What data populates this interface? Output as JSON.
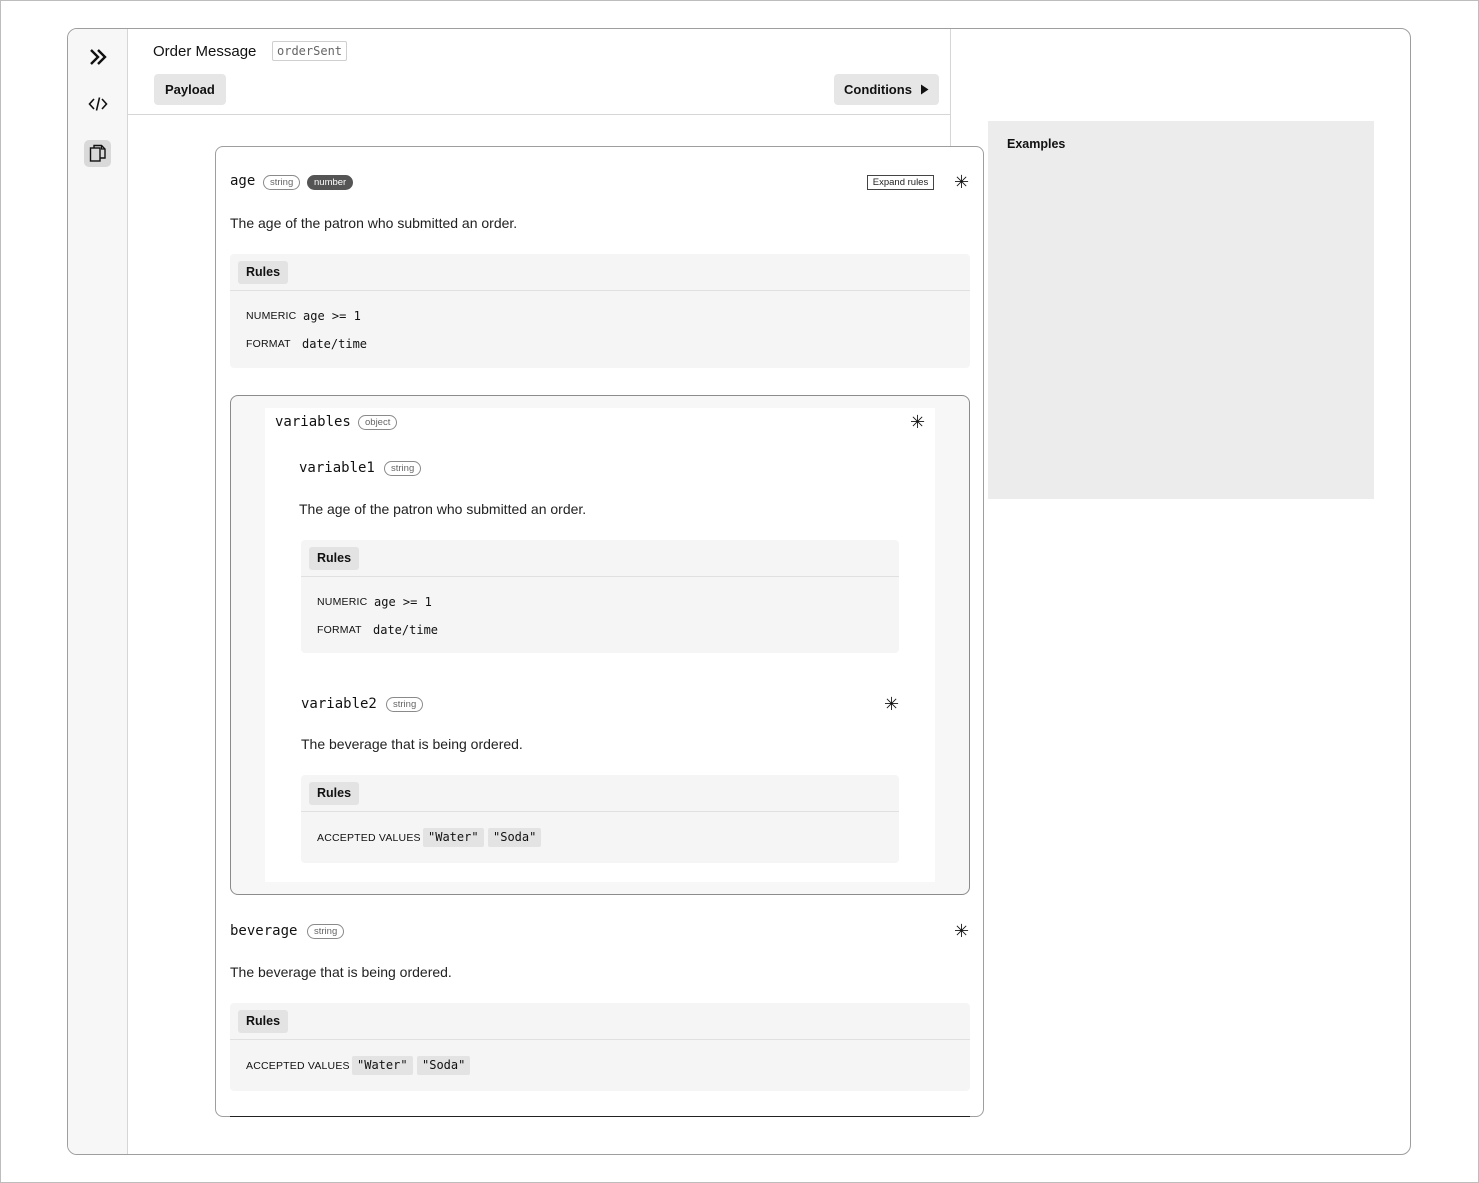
{
  "sidebar": {
    "icons": [
      "chevrons-right-icon",
      "code-icon",
      "document-copy-icon"
    ]
  },
  "header": {
    "title": "Order Message",
    "event_tag": "orderSent",
    "tab_payload": "Payload",
    "conditions_label": "Conditions"
  },
  "fields": {
    "age": {
      "name": "age",
      "types": [
        "string",
        "number"
      ],
      "expand_rules": "Expand rules",
      "required_mark": "✳",
      "description": "The age of the patron who submitted an order.",
      "rules_label": "Rules",
      "rules": [
        {
          "key": "NUMERIC",
          "value": "age >= 1"
        },
        {
          "key": "FORMAT",
          "value": "date/time"
        }
      ]
    },
    "variables": {
      "name": "variables",
      "type": "object",
      "required_mark": "✳",
      "variable1": {
        "name": "variable1",
        "type": "string",
        "description": "The age of the patron who submitted an order.",
        "rules_label": "Rules",
        "rules": [
          {
            "key": "NUMERIC",
            "value": "age >= 1"
          },
          {
            "key": "FORMAT",
            "value": "date/time"
          }
        ]
      },
      "variable2": {
        "name": "variable2",
        "type": "string",
        "required_mark": "✳",
        "description": "The beverage that is being ordered.",
        "rules_label": "Rules",
        "accepted_key": "ACCEPTED VALUES",
        "accepted_values": [
          "\"Water\"",
          "\"Soda\""
        ]
      }
    },
    "beverage": {
      "name": "beverage",
      "type": "string",
      "required_mark": "✳",
      "description": "The beverage that is being ordered.",
      "rules_label": "Rules",
      "accepted_key": "ACCEPTED VALUES",
      "accepted_values": [
        "\"Water\"",
        "\"Soda\""
      ]
    }
  },
  "examples": {
    "label": "Examples"
  }
}
